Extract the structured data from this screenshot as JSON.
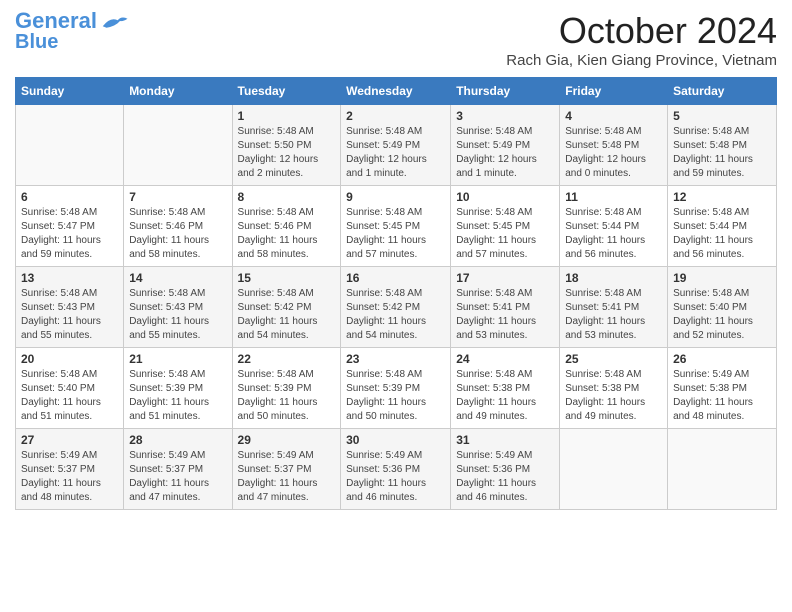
{
  "header": {
    "logo_line1": "General",
    "logo_line2": "Blue",
    "main_title": "October 2024",
    "subtitle": "Rach Gia, Kien Giang Province, Vietnam"
  },
  "weekdays": [
    "Sunday",
    "Monday",
    "Tuesday",
    "Wednesday",
    "Thursday",
    "Friday",
    "Saturday"
  ],
  "weeks": [
    [
      {
        "num": "",
        "info": ""
      },
      {
        "num": "",
        "info": ""
      },
      {
        "num": "1",
        "info": "Sunrise: 5:48 AM\nSunset: 5:50 PM\nDaylight: 12 hours\nand 2 minutes."
      },
      {
        "num": "2",
        "info": "Sunrise: 5:48 AM\nSunset: 5:49 PM\nDaylight: 12 hours\nand 1 minute."
      },
      {
        "num": "3",
        "info": "Sunrise: 5:48 AM\nSunset: 5:49 PM\nDaylight: 12 hours\nand 1 minute."
      },
      {
        "num": "4",
        "info": "Sunrise: 5:48 AM\nSunset: 5:48 PM\nDaylight: 12 hours\nand 0 minutes."
      },
      {
        "num": "5",
        "info": "Sunrise: 5:48 AM\nSunset: 5:48 PM\nDaylight: 11 hours\nand 59 minutes."
      }
    ],
    [
      {
        "num": "6",
        "info": "Sunrise: 5:48 AM\nSunset: 5:47 PM\nDaylight: 11 hours\nand 59 minutes."
      },
      {
        "num": "7",
        "info": "Sunrise: 5:48 AM\nSunset: 5:46 PM\nDaylight: 11 hours\nand 58 minutes."
      },
      {
        "num": "8",
        "info": "Sunrise: 5:48 AM\nSunset: 5:46 PM\nDaylight: 11 hours\nand 58 minutes."
      },
      {
        "num": "9",
        "info": "Sunrise: 5:48 AM\nSunset: 5:45 PM\nDaylight: 11 hours\nand 57 minutes."
      },
      {
        "num": "10",
        "info": "Sunrise: 5:48 AM\nSunset: 5:45 PM\nDaylight: 11 hours\nand 57 minutes."
      },
      {
        "num": "11",
        "info": "Sunrise: 5:48 AM\nSunset: 5:44 PM\nDaylight: 11 hours\nand 56 minutes."
      },
      {
        "num": "12",
        "info": "Sunrise: 5:48 AM\nSunset: 5:44 PM\nDaylight: 11 hours\nand 56 minutes."
      }
    ],
    [
      {
        "num": "13",
        "info": "Sunrise: 5:48 AM\nSunset: 5:43 PM\nDaylight: 11 hours\nand 55 minutes."
      },
      {
        "num": "14",
        "info": "Sunrise: 5:48 AM\nSunset: 5:43 PM\nDaylight: 11 hours\nand 55 minutes."
      },
      {
        "num": "15",
        "info": "Sunrise: 5:48 AM\nSunset: 5:42 PM\nDaylight: 11 hours\nand 54 minutes."
      },
      {
        "num": "16",
        "info": "Sunrise: 5:48 AM\nSunset: 5:42 PM\nDaylight: 11 hours\nand 54 minutes."
      },
      {
        "num": "17",
        "info": "Sunrise: 5:48 AM\nSunset: 5:41 PM\nDaylight: 11 hours\nand 53 minutes."
      },
      {
        "num": "18",
        "info": "Sunrise: 5:48 AM\nSunset: 5:41 PM\nDaylight: 11 hours\nand 53 minutes."
      },
      {
        "num": "19",
        "info": "Sunrise: 5:48 AM\nSunset: 5:40 PM\nDaylight: 11 hours\nand 52 minutes."
      }
    ],
    [
      {
        "num": "20",
        "info": "Sunrise: 5:48 AM\nSunset: 5:40 PM\nDaylight: 11 hours\nand 51 minutes."
      },
      {
        "num": "21",
        "info": "Sunrise: 5:48 AM\nSunset: 5:39 PM\nDaylight: 11 hours\nand 51 minutes."
      },
      {
        "num": "22",
        "info": "Sunrise: 5:48 AM\nSunset: 5:39 PM\nDaylight: 11 hours\nand 50 minutes."
      },
      {
        "num": "23",
        "info": "Sunrise: 5:48 AM\nSunset: 5:39 PM\nDaylight: 11 hours\nand 50 minutes."
      },
      {
        "num": "24",
        "info": "Sunrise: 5:48 AM\nSunset: 5:38 PM\nDaylight: 11 hours\nand 49 minutes."
      },
      {
        "num": "25",
        "info": "Sunrise: 5:48 AM\nSunset: 5:38 PM\nDaylight: 11 hours\nand 49 minutes."
      },
      {
        "num": "26",
        "info": "Sunrise: 5:49 AM\nSunset: 5:38 PM\nDaylight: 11 hours\nand 48 minutes."
      }
    ],
    [
      {
        "num": "27",
        "info": "Sunrise: 5:49 AM\nSunset: 5:37 PM\nDaylight: 11 hours\nand 48 minutes."
      },
      {
        "num": "28",
        "info": "Sunrise: 5:49 AM\nSunset: 5:37 PM\nDaylight: 11 hours\nand 47 minutes."
      },
      {
        "num": "29",
        "info": "Sunrise: 5:49 AM\nSunset: 5:37 PM\nDaylight: 11 hours\nand 47 minutes."
      },
      {
        "num": "30",
        "info": "Sunrise: 5:49 AM\nSunset: 5:36 PM\nDaylight: 11 hours\nand 46 minutes."
      },
      {
        "num": "31",
        "info": "Sunrise: 5:49 AM\nSunset: 5:36 PM\nDaylight: 11 hours\nand 46 minutes."
      },
      {
        "num": "",
        "info": ""
      },
      {
        "num": "",
        "info": ""
      }
    ]
  ]
}
